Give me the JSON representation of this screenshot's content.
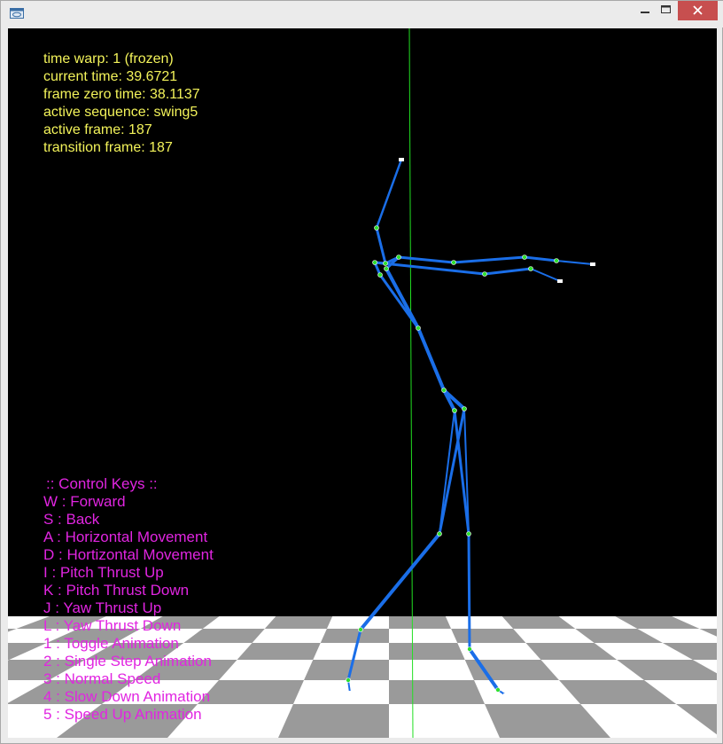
{
  "window": {
    "icon": "app-window-icon",
    "controls": [
      "minimize-icon",
      "maximize-icon",
      "close-icon"
    ],
    "colors": {
      "close": "#c74f4f",
      "viewport_bg": "#000000",
      "hud_text": "#f3f35a",
      "key_text": "#e125e1",
      "bone": "#1a6ee8",
      "joint": "#2ee02e",
      "axis": "#22e022"
    }
  },
  "hud": {
    "time_warp": "time warp: 1 (frozen)",
    "current_time": "current time: 39.6721",
    "frame_zero_time": "frame zero time: 38.1137",
    "active_sequence": "active sequence: swing5",
    "active_frame": "active frame: 187",
    "transition_frame": "transition frame: 187"
  },
  "controls": {
    "header": ":: Control Keys ::",
    "keys": [
      "W : Forward",
      "S : Back",
      "A : Horizontal Movement",
      "D : Hortizontal Movement",
      "I : Pitch Thrust Up",
      "K : Pitch Thrust Down",
      "J : Yaw Thrust Up",
      "L : Yaw Thrust Down",
      "1 : Toggle Animation",
      "2 : Single Step Animation",
      "3 : Normal Speed",
      "4 : Slow Down Animation",
      "5 : Speed Up Animation"
    ]
  }
}
